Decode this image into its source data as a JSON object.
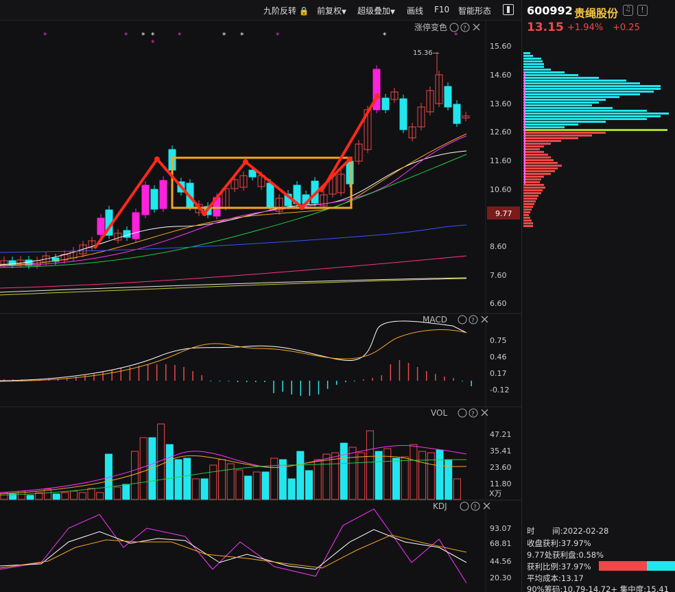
{
  "toolbar": {
    "reversal": "九阶反转",
    "adjust": "前复权",
    "overlay": "超级叠加",
    "draw": "画线",
    "f10": "F10",
    "pattern": "智能形态"
  },
  "stock": {
    "code": "600992",
    "name": "贵绳股份",
    "price": "13.15",
    "change_pct": "+1.94%",
    "change": "+0.25"
  },
  "main": {
    "indicator": "涨停变色",
    "y_ticks": [
      "15.60",
      "14.60",
      "13.60",
      "12.60",
      "11.60",
      "10.60",
      "8.60",
      "7.60",
      "6.60"
    ],
    "high_label": "15.36",
    "current_label": "9.77"
  },
  "macd": {
    "name": "MACD",
    "y_ticks": [
      "0.75",
      "0.46",
      "0.17",
      "-0.12"
    ]
  },
  "vol": {
    "name": "VOL",
    "y_ticks": [
      "47.21",
      "35.41",
      "23.60",
      "11.80"
    ],
    "unit": "X万"
  },
  "kdj": {
    "name": "KDJ",
    "y_ticks": [
      "93.07",
      "68.81",
      "44.56",
      "20.30"
    ]
  },
  "chip": {
    "time_label": "时",
    "time_label2": "间:2022-02-28",
    "profit": "收盘获利:37.97%",
    "at_price": "9.77处获利盘:0.58%",
    "ratio": "获利比例:37.97%",
    "avg_cost": "平均成本:13.17",
    "range90": "90%筹码:10.79-14.72+ 集中度:15.41"
  },
  "colors": {
    "up": "#f04848",
    "down": "#22e6ee",
    "limit": "#ff22dd",
    "box": "#f5a623",
    "arrow": "#ff2a1a"
  }
}
